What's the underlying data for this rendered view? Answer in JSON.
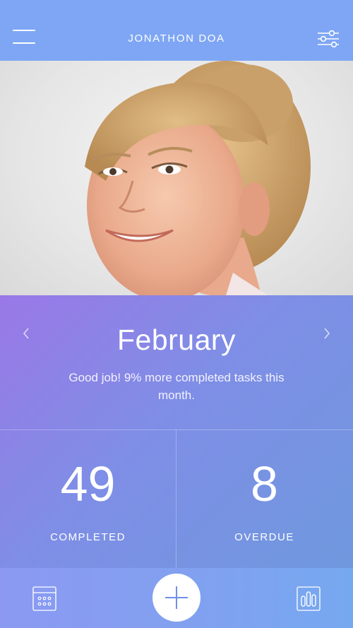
{
  "header": {
    "title": "JONATHON DOA",
    "menu_icon": "menu-icon",
    "filter_icon": "filter-icon"
  },
  "photo": {
    "description_icon": "profile-photo"
  },
  "month": {
    "name": "February",
    "prev_icon": "chevron-left-icon",
    "next_icon": "chevron-right-icon",
    "message": "Good job! 9% more completed tasks this month."
  },
  "stats": {
    "completed": {
      "value": "49",
      "label": "COMPLETED"
    },
    "overdue": {
      "value": "8",
      "label": "OVERDUE"
    }
  },
  "bottom_bar": {
    "left_icon": "calendar-icon",
    "center_icon": "plus-icon",
    "right_icon": "bar-chart-icon"
  },
  "colors": {
    "header": "#7ea6f4",
    "gradient_start": "#9a78e6",
    "gradient_end": "#6f98de",
    "accent": "#6f8fe6",
    "text": "#ffffff"
  }
}
